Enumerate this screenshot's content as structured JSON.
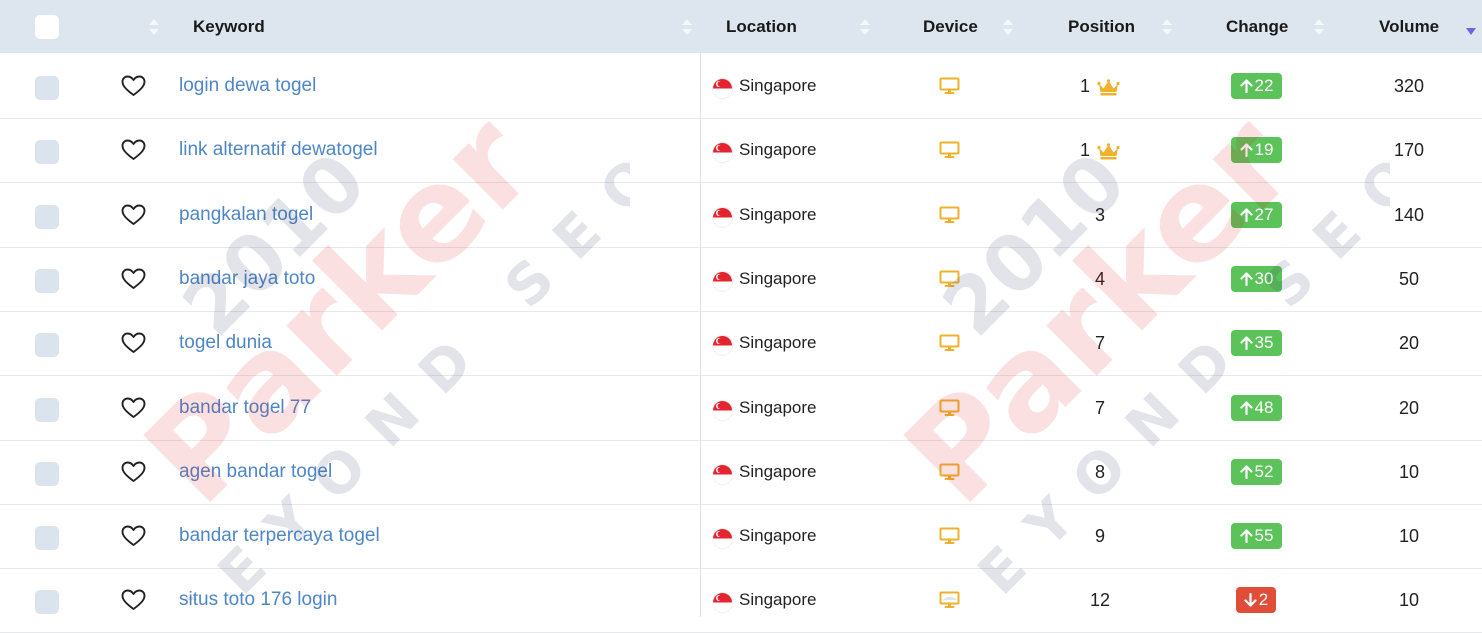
{
  "header": {
    "keyword": "Keyword",
    "location": "Location",
    "device": "Device",
    "position": "Position",
    "change": "Change",
    "volume": "Volume"
  },
  "watermark": {
    "year": "2010",
    "brand": "Parker",
    "tagline": "BEYOND SEO"
  },
  "colors": {
    "header_bg": "#dde6ef",
    "keyword_link": "#4f86c6",
    "change_up": "#5cc25a",
    "change_down": "#e04e3a",
    "device_icon": "#efb12b",
    "crown": "#efb12b"
  },
  "rows": [
    {
      "keyword": "login dewa togel",
      "location": "Singapore",
      "device": "desktop-icon",
      "position": "1",
      "crown": true,
      "change": "22",
      "direction": "up",
      "volume": "320"
    },
    {
      "keyword": "link alternatif dewatogel",
      "location": "Singapore",
      "device": "desktop-icon",
      "position": "1",
      "crown": true,
      "change": "19",
      "direction": "up",
      "volume": "170"
    },
    {
      "keyword": "pangkalan togel",
      "location": "Singapore",
      "device": "desktop-icon",
      "position": "3",
      "crown": false,
      "change": "27",
      "direction": "up",
      "volume": "140"
    },
    {
      "keyword": "bandar jaya toto",
      "location": "Singapore",
      "device": "desktop-icon",
      "position": "4",
      "crown": false,
      "change": "30",
      "direction": "up",
      "volume": "50"
    },
    {
      "keyword": "togel dunia",
      "location": "Singapore",
      "device": "desktop-icon",
      "position": "7",
      "crown": false,
      "change": "35",
      "direction": "up",
      "volume": "20"
    },
    {
      "keyword": "bandar togel 77",
      "location": "Singapore",
      "device": "desktop-icon",
      "position": "7",
      "crown": false,
      "change": "48",
      "direction": "up",
      "volume": "20"
    },
    {
      "keyword": "agen bandar togel",
      "location": "Singapore",
      "device": "desktop-icon",
      "position": "8",
      "crown": false,
      "change": "52",
      "direction": "up",
      "volume": "10"
    },
    {
      "keyword": "bandar terpercaya togel",
      "location": "Singapore",
      "device": "desktop-icon",
      "position": "9",
      "crown": false,
      "change": "55",
      "direction": "up",
      "volume": "10"
    },
    {
      "keyword": "situs toto 176 login",
      "location": "Singapore",
      "device": "desktop-icon",
      "position": "12",
      "crown": false,
      "change": "2",
      "direction": "down",
      "volume": "10"
    }
  ]
}
